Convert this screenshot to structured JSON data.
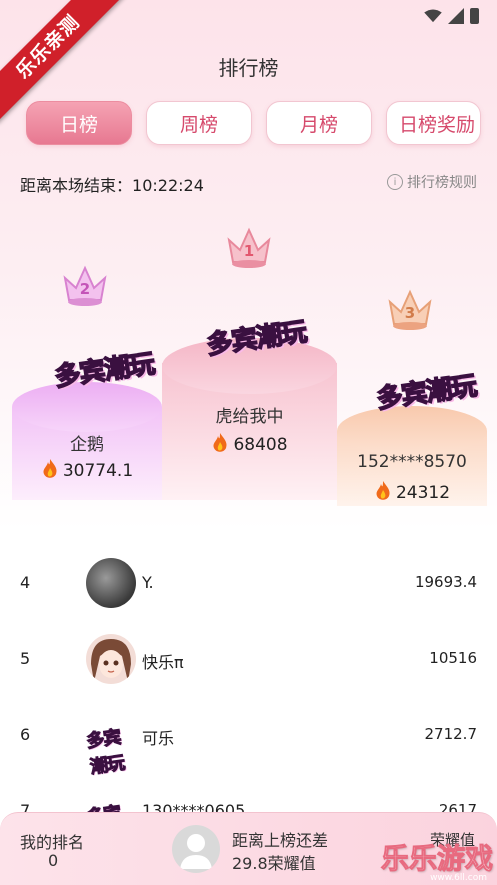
{
  "corner_badge": "乐乐亲测",
  "header": {
    "title": "排行榜"
  },
  "tabs": [
    {
      "label": "日榜",
      "active": true
    },
    {
      "label": "周榜",
      "active": false
    },
    {
      "label": "月榜",
      "active": false
    },
    {
      "label": "日榜奖励",
      "active": false
    }
  ],
  "countdown": {
    "label": "距离本场结束：",
    "time": "10:22:24"
  },
  "rules_link": "排行榜规则",
  "podium": [
    {
      "rank": "1",
      "name": "虎给我中",
      "score": "68408",
      "logo": "多宾潮玩"
    },
    {
      "rank": "2",
      "name": "企鹅",
      "score": "30774.1",
      "logo": "多宾潮玩"
    },
    {
      "rank": "3",
      "name": "152****8570",
      "score": "24312",
      "logo": "多宾潮玩"
    }
  ],
  "list": [
    {
      "rank": "4",
      "name": "Y.",
      "score": "19693.4",
      "avatar": "dark-avatar"
    },
    {
      "rank": "5",
      "name": "快乐π",
      "score": "10516",
      "avatar": "anime-avatar"
    },
    {
      "rank": "6",
      "name": "可乐",
      "score": "2712.7",
      "avatar": "logo-avatar"
    },
    {
      "rank": "7",
      "name": "130****0605",
      "score": "2617",
      "avatar": "logo-avatar"
    }
  ],
  "bottom": {
    "my_rank_label": "我的排名",
    "my_rank_value": "0",
    "gap_label": "距离上榜还差",
    "gap_value": "29.8荣耀值",
    "honor_label": "荣耀值"
  },
  "watermark": {
    "text": "乐乐游戏",
    "url": "www.6ll.com"
  },
  "colors": {
    "accent": "#e77891",
    "podium_pink": "#f7c6d3",
    "podium_violet": "#e6a8f2",
    "podium_peach": "#f9d7c3"
  }
}
